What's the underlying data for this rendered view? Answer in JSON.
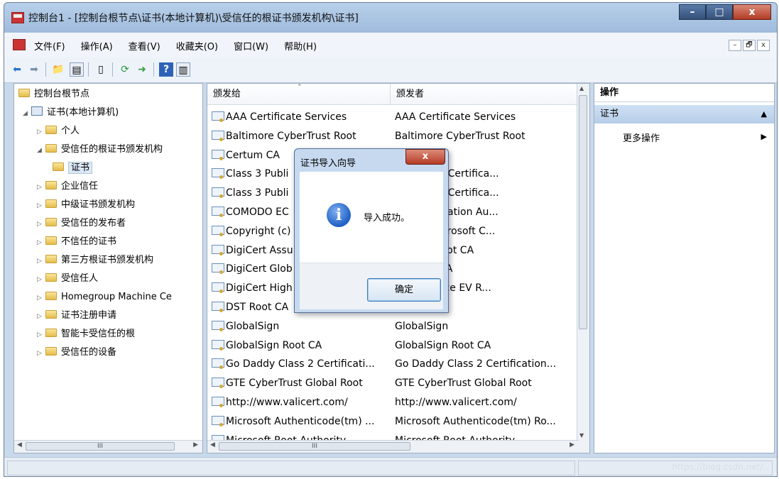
{
  "window": {
    "title": "控制台1 - [控制台根节点\\证书(本地计算机)\\受信任的根证书颁发机构\\证书]",
    "btn_min": "–",
    "btn_max": "□",
    "btn_close": "x"
  },
  "menu": {
    "items": [
      "文件(F)",
      "操作(A)",
      "查看(V)",
      "收藏夹(O)",
      "窗口(W)",
      "帮助(H)"
    ],
    "mdi_min": "–",
    "mdi_restore": "🗗",
    "mdi_close": "x"
  },
  "tree": {
    "root": "控制台根节点",
    "computer": "证书(本地计算机)",
    "items": [
      "个人",
      "受信任的根证书颁发机构",
      "证书",
      "企业信任",
      "中级证书颁发机构",
      "受信任的发布者",
      "不信任的证书",
      "第三方根证书颁发机构",
      "受信任人",
      "Homegroup Machine Ce",
      "证书注册申请",
      "智能卡受信任的根",
      "受信任的设备"
    ],
    "scroll_thumb": "III"
  },
  "list": {
    "col_issued_to": "颁发给",
    "col_issued_by": "颁发者",
    "rows": [
      [
        "AAA Certificate Services",
        "AAA Certificate Services"
      ],
      [
        "Baltimore CyberTrust Root",
        "Baltimore CyberTrust Root"
      ],
      [
        "Certum CA",
        ""
      ],
      [
        "Class 3 Publi",
        "ic Primary Certifica..."
      ],
      [
        "Class 3 Publi",
        "ic Primary Certifica..."
      ],
      [
        "COMODO EC",
        "CC Certification Au..."
      ],
      [
        "Copyright (c)",
        ") 1997 Microsoft C..."
      ],
      [
        "DigiCert Assu",
        "ured ID Root CA"
      ],
      [
        "DigiCert Glob",
        "bal Root CA"
      ],
      [
        "DigiCert High",
        "h Assurance EV R..."
      ],
      [
        "DST Root CA",
        "A X3"
      ],
      [
        "GlobalSign",
        "GlobalSign"
      ],
      [
        "GlobalSign Root CA",
        "GlobalSign Root CA"
      ],
      [
        "Go Daddy Class 2 Certificati...",
        "Go Daddy Class 2 Certification..."
      ],
      [
        "GTE CyberTrust Global Root",
        "GTE CyberTrust Global Root"
      ],
      [
        "http://www.valicert.com/",
        "http://www.valicert.com/"
      ],
      [
        "Microsoft Authenticode(tm) ...",
        "Microsoft Authenticode(tm) Ro..."
      ],
      [
        "Microsoft Root Authority",
        "Microsoft Root Authority"
      ]
    ],
    "scroll_thumb": "III"
  },
  "actions": {
    "header": "操作",
    "section": "证书",
    "more": "更多操作"
  },
  "dialog": {
    "title": "证书导入向导",
    "close": "x",
    "message": "导入成功。",
    "ok": "确定"
  },
  "status": {
    "watermark": "https://blog.csdn.net/..."
  }
}
